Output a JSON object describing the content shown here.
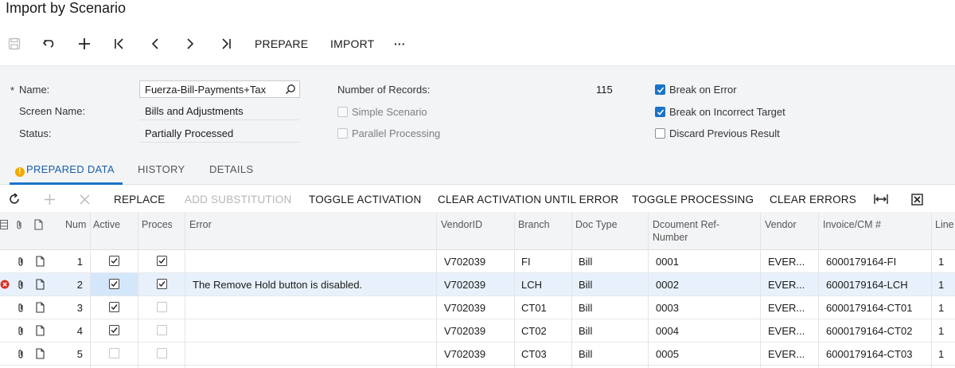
{
  "title": "Import by Scenario",
  "toolbar": {
    "prepare_label": "PREPARE",
    "import_label": "IMPORT",
    "more_label": "···"
  },
  "summary": {
    "required_mark": "*",
    "name_label": "Name:",
    "name_value": "Fuerza-Bill-Payments+Tax",
    "screen_name_label": "Screen Name:",
    "screen_name_value": "Bills and Adjustments",
    "status_label": "Status:",
    "status_value": "Partially Processed",
    "records_label": "Number of Records:",
    "records_value": "115",
    "simple_scenario_label": "Simple Scenario",
    "parallel_processing_label": "Parallel Processing",
    "break_on_error_label": "Break on Error",
    "break_on_incorrect_target_label": "Break on Incorrect Target",
    "discard_previous_result_label": "Discard Previous Result"
  },
  "tabs": {
    "prepared_data": "PREPARED DATA",
    "history": "HISTORY",
    "details": "DETAILS"
  },
  "grid_toolbar": {
    "replace": "REPLACE",
    "add_substitution": "ADD SUBSTITUTION",
    "toggle_activation": "TOGGLE ACTIVATION",
    "clear_activation_until_error": "CLEAR ACTIVATION UNTIL ERROR",
    "toggle_processing": "TOGGLE PROCESSING",
    "clear_errors": "CLEAR ERRORS"
  },
  "grid": {
    "headers": {
      "num": "Num",
      "active": "Active",
      "processed": "Proces",
      "error": "Error",
      "vendor_id": "VendorID",
      "branch": "Branch",
      "doc_type": "Doc Type",
      "doc_ref_line1": "Dcoument Ref-",
      "doc_ref_line2": "Number",
      "vendor": "Vendor",
      "invoice": "Invoice/CM #",
      "line": "Line"
    },
    "rows": [
      {
        "num": "1",
        "active": true,
        "processed": true,
        "error": "",
        "vendor_id": "V702039",
        "branch": "FI",
        "doc_type": "Bill",
        "doc_ref": "0001",
        "vendor": "EVER...",
        "invoice": "6000179164-FI",
        "line": "1"
      },
      {
        "num": "2",
        "active": true,
        "processed": true,
        "error": "The Remove Hold button is disabled.",
        "vendor_id": "V702039",
        "branch": "LCH",
        "doc_type": "Bill",
        "doc_ref": "0002",
        "vendor": "EVER...",
        "invoice": "6000179164-LCH",
        "line": "1"
      },
      {
        "num": "3",
        "active": true,
        "processed": false,
        "error": "",
        "vendor_id": "V702039",
        "branch": "CT01",
        "doc_type": "Bill",
        "doc_ref": "0003",
        "vendor": "EVER...",
        "invoice": "6000179164-CT01",
        "line": "1"
      },
      {
        "num": "4",
        "active": true,
        "processed": false,
        "error": "",
        "vendor_id": "V702039",
        "branch": "CT02",
        "doc_type": "Bill",
        "doc_ref": "0004",
        "vendor": "EVER...",
        "invoice": "6000179164-CT02",
        "line": "1"
      },
      {
        "num": "5",
        "active": false,
        "processed": false,
        "error": "",
        "vendor_id": "V702039",
        "branch": "CT03",
        "doc_type": "Bill",
        "doc_ref": "0005",
        "vendor": "EVER...",
        "invoice": "6000179164-CT03",
        "line": "1"
      }
    ]
  },
  "colors": {
    "accent": "#1a73c9",
    "tab_active": "#1a5fa8",
    "warning": "#f2a900",
    "error": "#d93025",
    "selected_row": "#e8f1fb"
  }
}
